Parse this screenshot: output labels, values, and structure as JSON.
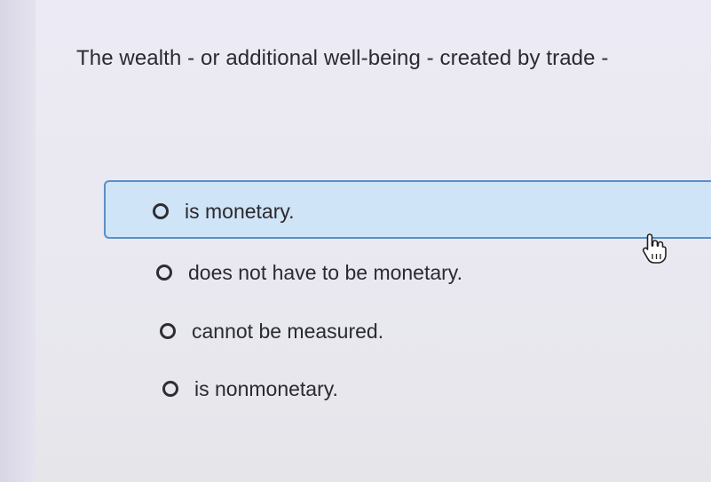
{
  "question": {
    "text": "The wealth - or additional well-being - created by trade -"
  },
  "options": [
    {
      "label": "is monetary.",
      "hovered": true
    },
    {
      "label": "does not have to be monetary.",
      "hovered": false
    },
    {
      "label": "cannot be measured.",
      "hovered": false
    },
    {
      "label": "is nonmonetary.",
      "hovered": false
    }
  ],
  "colors": {
    "highlight_fill": "#cfe4f6",
    "highlight_border": "#5b8fc6",
    "text": "#2a2a30"
  },
  "icons": {
    "cursor": "pointer-hand-icon",
    "radio": "radio-unselected-icon"
  }
}
